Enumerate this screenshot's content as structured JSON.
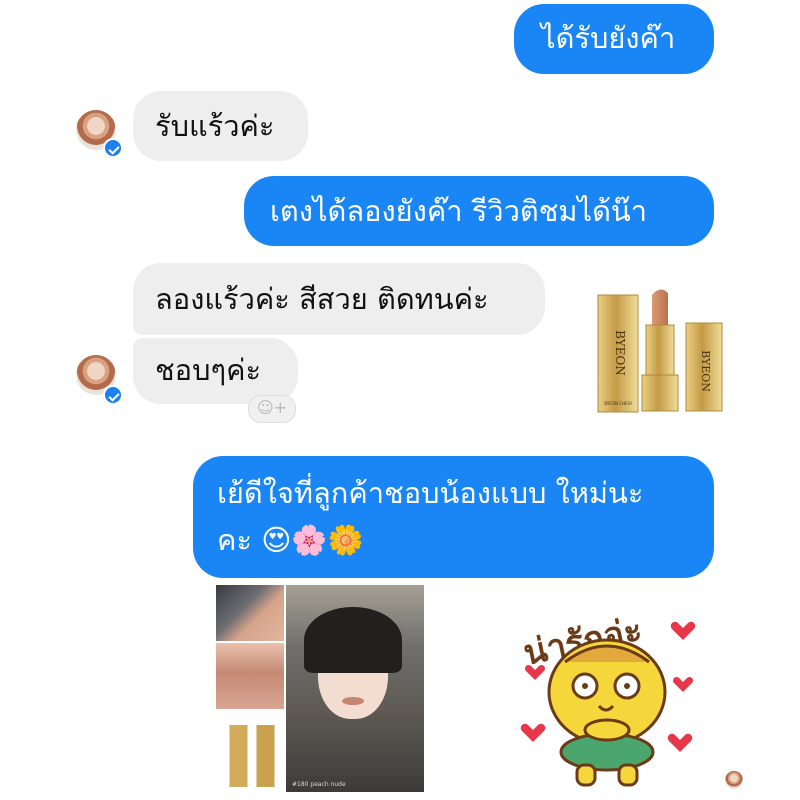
{
  "messages": {
    "m1": "ได้รับยังค๊า",
    "m2": "รับแร้วค่ะ",
    "m3": "เตงได้ลองยังค๊า รีวิวติชมได้น๊า",
    "m4": "ลองแร้วค่ะ สีสวย ติดทนค่ะ",
    "m5": "ชอบๆค่ะ",
    "m6_line1": "เย้ดีใจที่ลูกค้าชอบน้องแบบ ใหม่นะ",
    "m6_line2": "คะ",
    "m6_emojis": "😍🌸🌼"
  },
  "reaction_button": "☺+",
  "product": {
    "brand": "BYEON",
    "small_label": "BYEON CHEUI"
  },
  "photo_caption": "#180 peach nude",
  "sticker_text": "น่ารักอ่ะ",
  "colors": {
    "outgoing_bubble": "#1a86f5",
    "incoming_bubble": "#eeeeee",
    "messenger_badge": "#1c80f0",
    "gold": "#c9a24e"
  },
  "icons": {
    "reaction": "add-reaction-icon",
    "badge": "messenger-badge-icon"
  }
}
